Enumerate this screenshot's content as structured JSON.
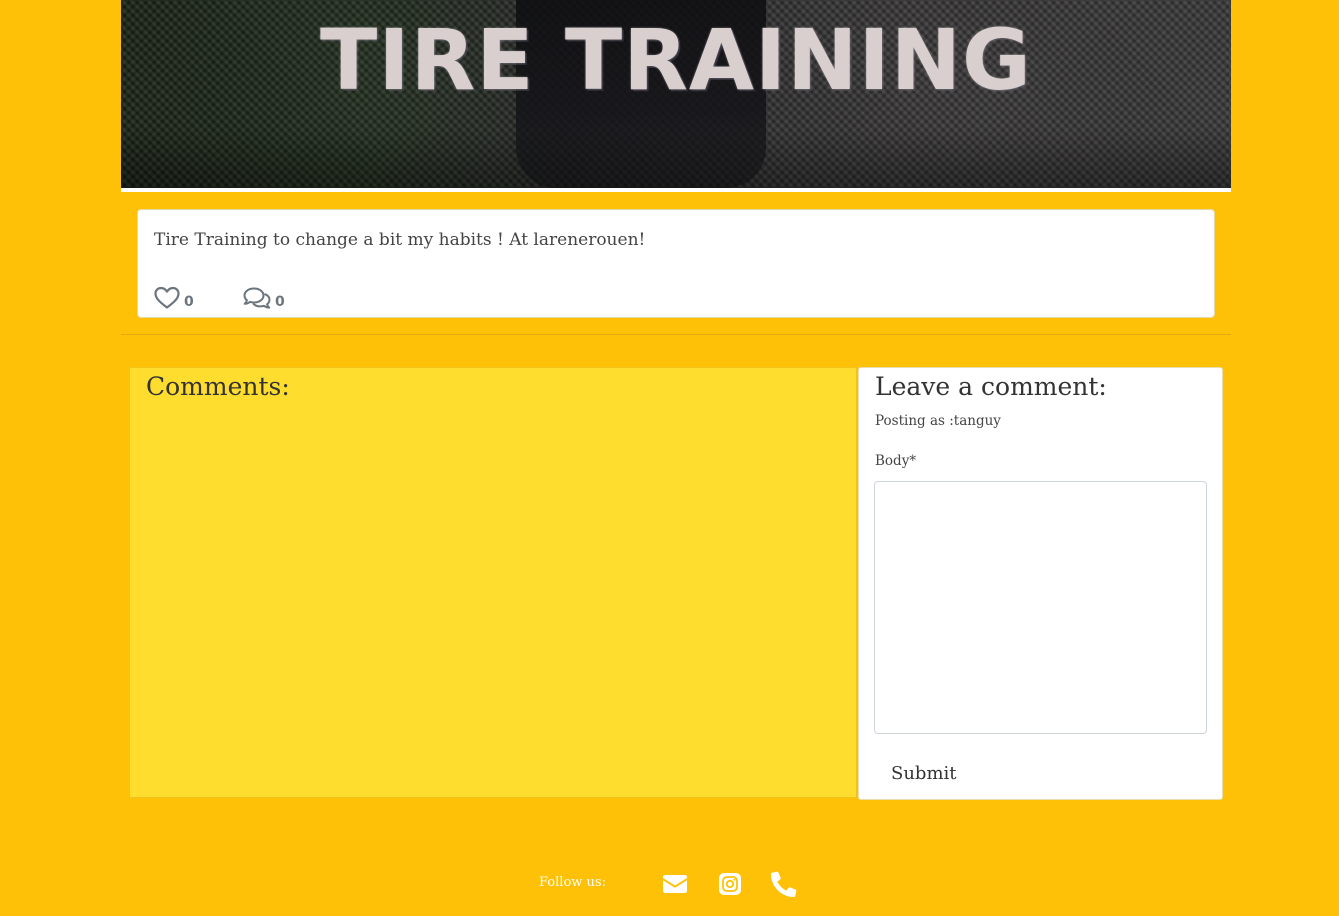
{
  "hero": {
    "title": "TIRE TRAINING"
  },
  "post": {
    "text": "Tire Training to change a bit my habits ! At larenerouen!",
    "likes": "0",
    "comments": "0",
    "like_icon": "heart-outline-icon",
    "comment_icon": "comments-icon"
  },
  "comments": {
    "title": "Comments:"
  },
  "leave_comment": {
    "title": "Leave a comment:",
    "posting_as": "Posting as :tanguy",
    "body_label": "Body*",
    "body_value": "",
    "submit_label": "Submit"
  },
  "footer": {
    "follow_label": "Follow us:",
    "icons": [
      "envelope-icon",
      "instagram-icon",
      "phone-icon"
    ]
  },
  "colors": {
    "page_background": "#FFC107",
    "comments_panel": "#FFDD2E",
    "card_background": "#FFFFFF",
    "muted_icon": "#6C757D"
  }
}
